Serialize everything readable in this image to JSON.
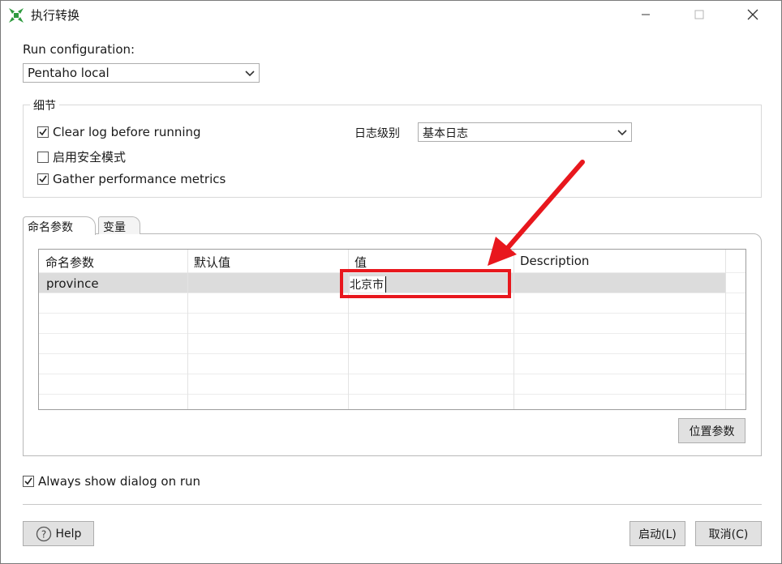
{
  "window": {
    "title": "执行转换"
  },
  "run_configuration": {
    "label": "Run configuration:",
    "selected": "Pentaho local"
  },
  "details_group": {
    "title": "细节",
    "clear_log": {
      "label": "Clear log before running",
      "checked": true
    },
    "safe_mode": {
      "label": "启用安全模式",
      "checked": false
    },
    "gather_metrics": {
      "label": "Gather performance metrics",
      "checked": true
    },
    "log_level_label": "日志级别",
    "log_level_value": "基本日志"
  },
  "tabs": [
    {
      "label": "命名参数",
      "active": true
    },
    {
      "label": "变量",
      "active": false
    }
  ],
  "params_table": {
    "headers": [
      "命名参数",
      "默认值",
      "值",
      "Description"
    ],
    "rows": [
      {
        "name": "province",
        "default": "",
        "value": "北京市",
        "description": ""
      }
    ]
  },
  "position_params_button": "位置参数",
  "always_show": {
    "label": "Always show dialog on run",
    "checked": true
  },
  "help_button": "Help",
  "launch_button": "启动(L)",
  "cancel_button": "取消(C)",
  "colors": {
    "annotation": "#e8171d",
    "app_icon_green": "#2e9a3e"
  },
  "icons": [
    "app-icon",
    "minimize-icon",
    "maximize-icon",
    "close-icon",
    "chevron-down-icon",
    "checkmark-icon",
    "help-icon",
    "annotation-arrow"
  ]
}
